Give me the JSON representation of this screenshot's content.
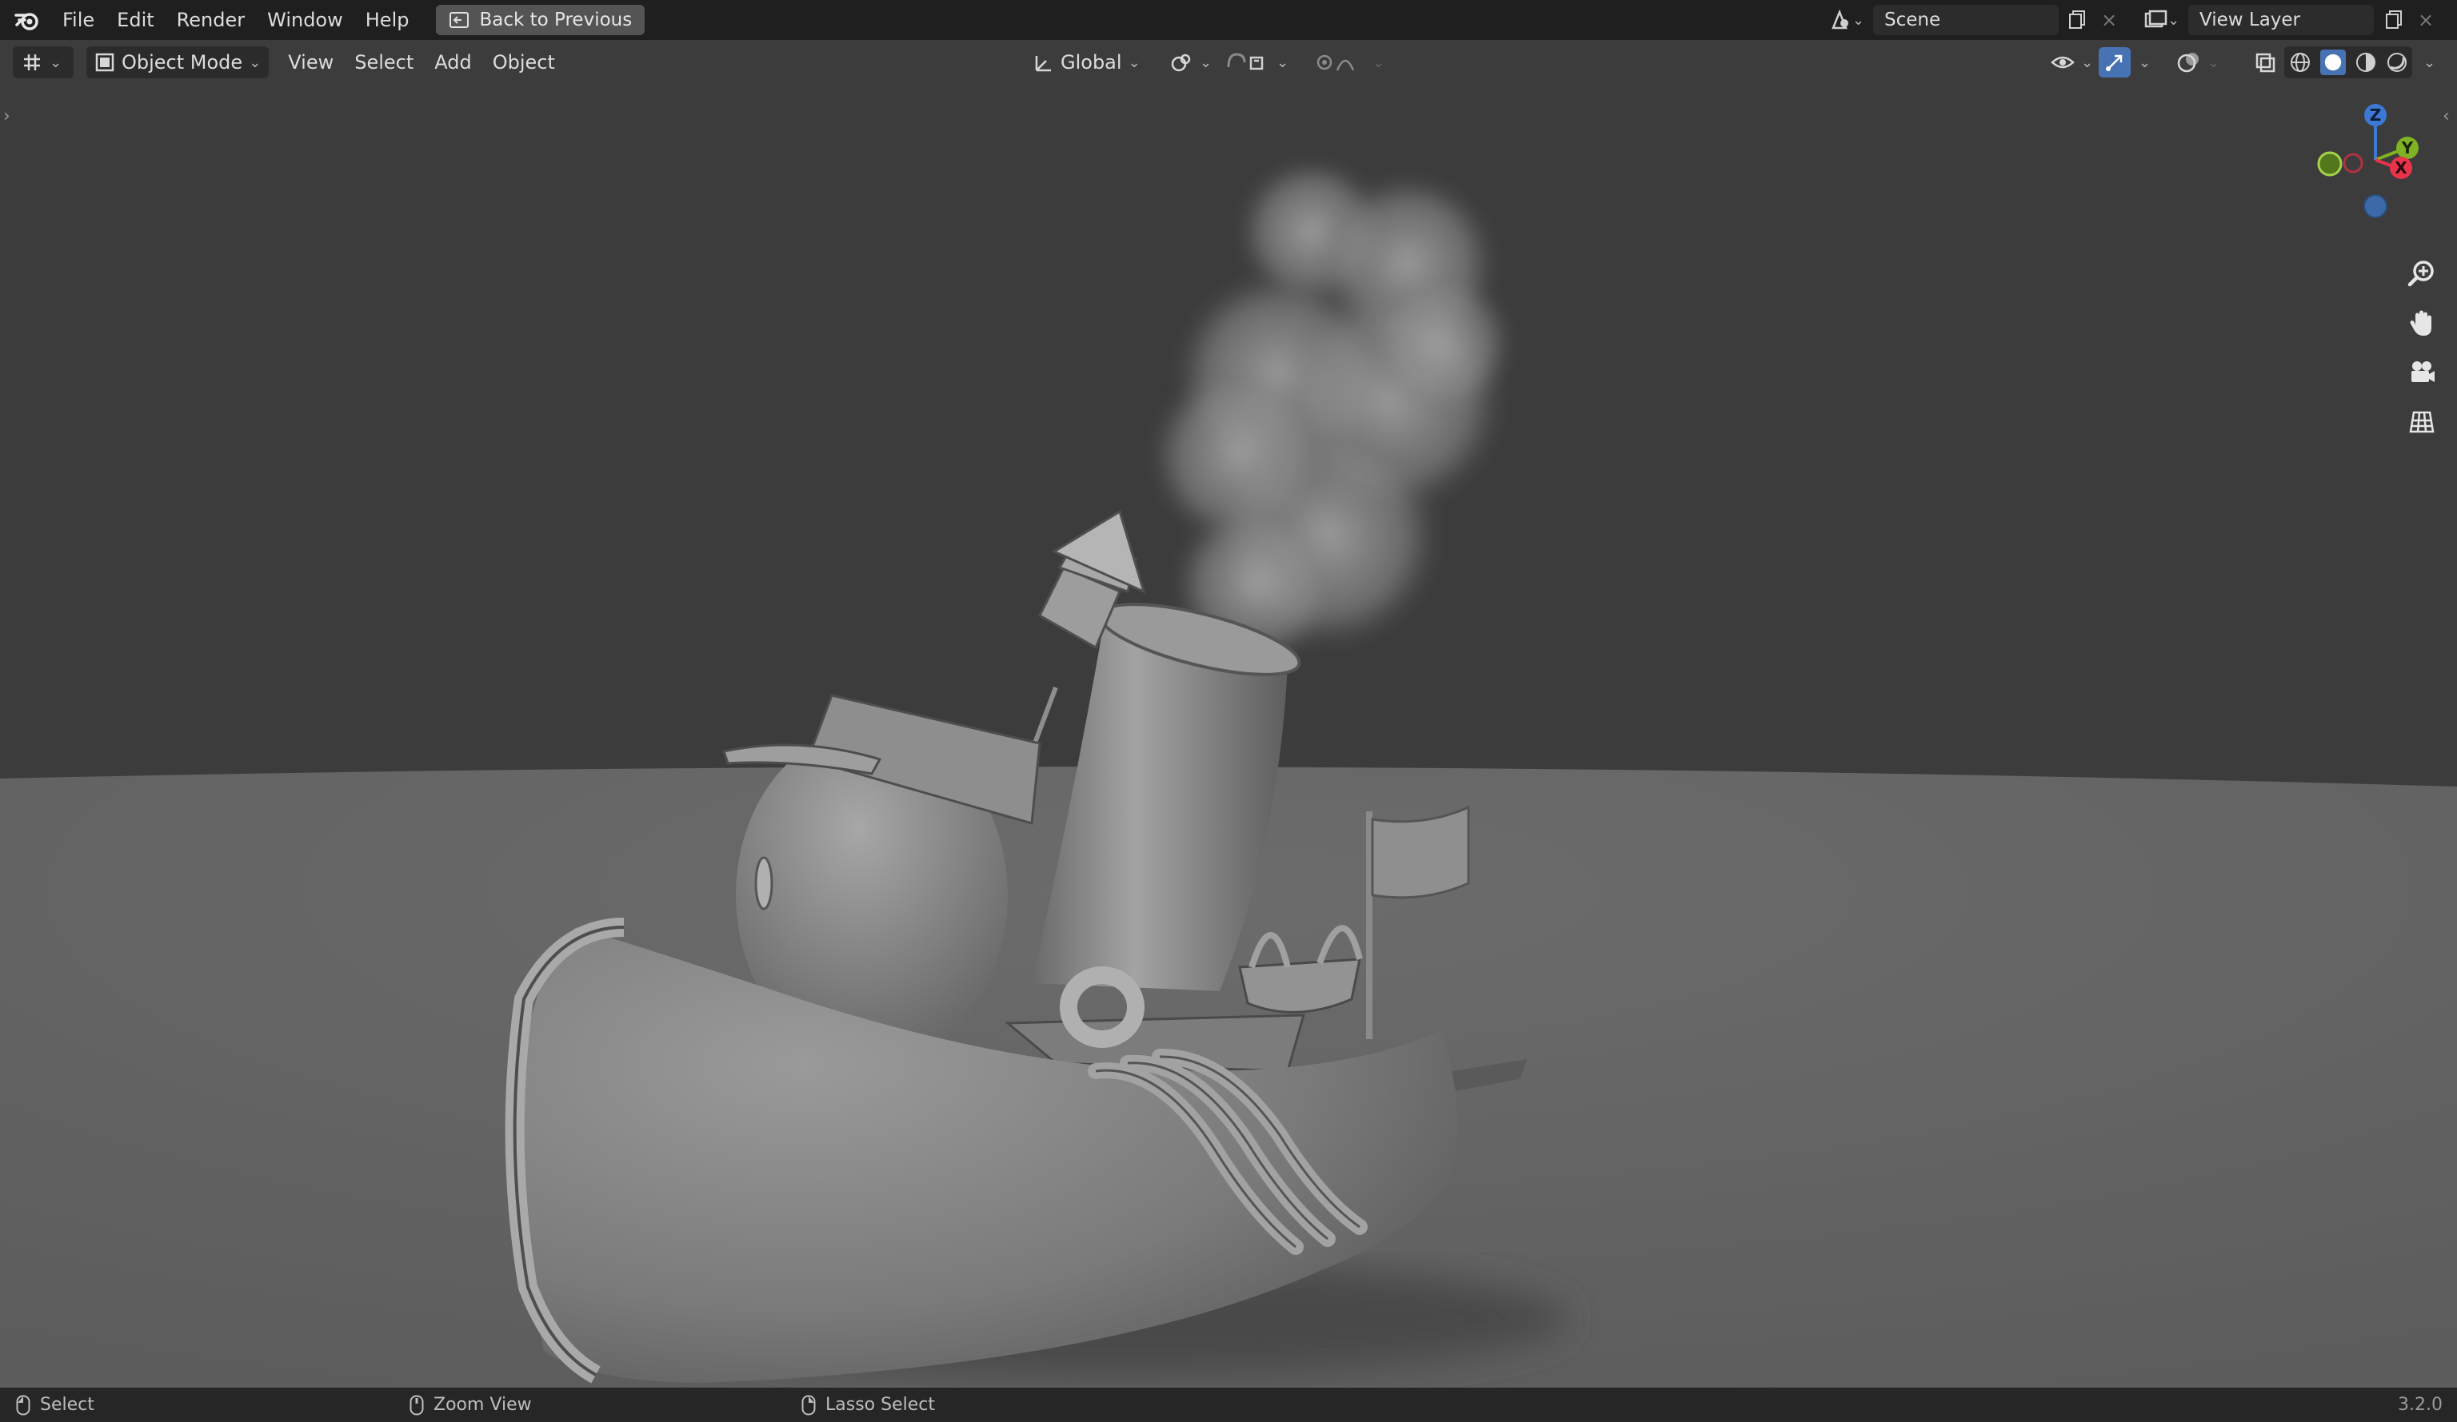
{
  "menu": {
    "items": [
      "File",
      "Edit",
      "Render",
      "Window",
      "Help"
    ],
    "back_button": "Back to Previous"
  },
  "scene": {
    "label": "Scene"
  },
  "view_layer": {
    "label": "View Layer"
  },
  "header": {
    "mode": "Object Mode",
    "menus": [
      "View",
      "Select",
      "Add",
      "Object"
    ],
    "transform_orientation": "Global"
  },
  "gizmo": {
    "z": "Z",
    "y": "Y",
    "x": "X"
  },
  "status": {
    "select": "Select",
    "zoom": "Zoom View",
    "lasso": "Lasso Select",
    "version": "3.2.0"
  },
  "colors": {
    "axis_x": "#e8334a",
    "axis_y": "#7fb324",
    "axis_z": "#3c79d5",
    "accent": "#4772b3"
  },
  "icons": [
    "blender-logo-icon",
    "back-icon",
    "scene-icon",
    "view-layer-icon",
    "editor-type-icon",
    "object-mode-icon",
    "transform-icon",
    "pivot-icon",
    "snap-icon",
    "proportional-icon",
    "visibility-icon",
    "gizmo-icon",
    "overlay-icon",
    "xray-icon",
    "wireframe-icon",
    "solid-icon",
    "material-icon",
    "rendered-icon",
    "zoom-icon",
    "hand-icon",
    "camera-icon",
    "grid-icon",
    "mouse-icon"
  ]
}
